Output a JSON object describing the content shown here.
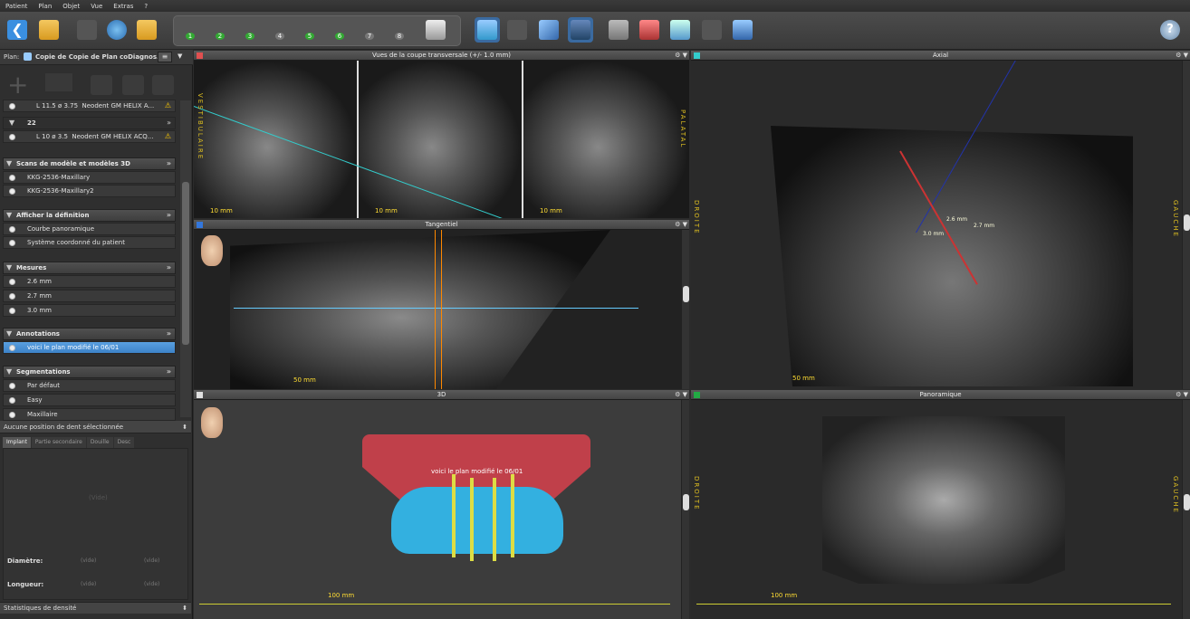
{
  "menu": [
    "Patient",
    "Plan",
    "Objet",
    "Vue",
    "Extras",
    "?"
  ],
  "toolbar": {
    "numbered_steps": [
      "1",
      "2",
      "3",
      "4",
      "5",
      "6",
      "7",
      "8"
    ]
  },
  "plan": {
    "label": "Plan:",
    "name": "Copie de Copie de Plan coDiagnos..."
  },
  "implants": [
    {
      "number": "L 11.5",
      "diameter": "3.75",
      "name": "Neodent GM HELIX A..."
    },
    {
      "tooth": "22"
    },
    {
      "number": "L 10",
      "diameter": "3.5",
      "name": "Neodent GM HELIX ACQ..."
    }
  ],
  "sections": {
    "scans": {
      "title": "Scans de modèle et modèles 3D",
      "items": [
        "KKG-2536-Maxillary",
        "KKG-2536-Maxillary2"
      ]
    },
    "definition": {
      "title": "Afficher la définition",
      "items": [
        "Courbe panoramique",
        "Système coordonné du patient"
      ]
    },
    "mesures": {
      "title": "Mesures",
      "items": [
        "2.6 mm",
        "2.7 mm",
        "3.0 mm"
      ]
    },
    "annotations": {
      "title": "Annotations",
      "items": [
        "voici le plan modifié le 06/01"
      ]
    },
    "segmentations": {
      "title": "Segmentations",
      "items": [
        "Par défaut",
        "Easy",
        "Maxillaire"
      ]
    }
  },
  "tooth_status": "Aucune position de dent sélectionnée",
  "tabs": [
    "Implant",
    "Partie secondaire",
    "Douille",
    "Desc"
  ],
  "empty_text": "(Vide)",
  "fields": {
    "diametre_label": "Diamètre:",
    "longueur_label": "Longueur:",
    "empty": "(vide)"
  },
  "density_stats": "Statistiques de densité",
  "views": {
    "transversal": {
      "title": "Vues de la coupe transversale (+/- 1.0 mm)",
      "scale": "10 mm",
      "left_label": "VESTIBULAIRE",
      "right_label": "PALATAL"
    },
    "axial": {
      "title": "Axial",
      "scale": "50 mm",
      "left_label": "DROITE",
      "right_label": "GAUCHE",
      "m1": "2.6 mm",
      "m2": "2.7 mm",
      "m3": "3.0 mm"
    },
    "tangential": {
      "title": "Tangentiel",
      "scale": "50 mm"
    },
    "view3d": {
      "title": "3D",
      "scale": "100 mm",
      "annotation": "voici le plan modifié le 06/01"
    },
    "panoramic": {
      "title": "Panoramique",
      "scale": "100 mm",
      "left_label": "DROITE",
      "right_label": "GAUCHE"
    }
  },
  "colors": {
    "accent": "#3c82c8",
    "scale": "#ffdd33",
    "panel_red": "#e05050",
    "panel_cyan": "#33cccc",
    "panel_blue": "#3377dd",
    "panel_green": "#22aa44"
  }
}
